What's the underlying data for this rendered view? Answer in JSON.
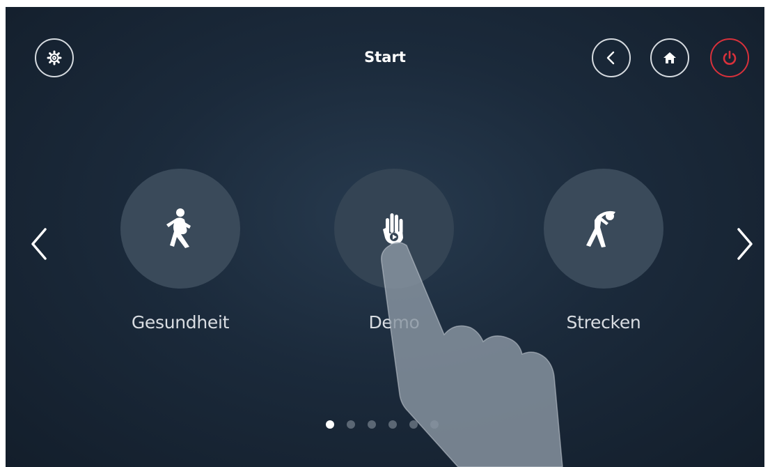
{
  "header": {
    "title": "Start",
    "settings_icon": "gear-icon",
    "back_icon": "chevron-left-icon",
    "home_icon": "home-icon",
    "power_icon": "power-icon"
  },
  "colors": {
    "background": "#1b2a3b",
    "tile_circle": "#3a4a5a",
    "power_accent": "#d8313b",
    "text": "#ffffff",
    "pager_active": "#ffffff",
    "pager_inactive": "#5b6774"
  },
  "carousel": {
    "tiles": [
      {
        "label": "Gesundheit",
        "icon": "walking-person-icon"
      },
      {
        "label": "Demo",
        "icon": "hand-play-icon"
      },
      {
        "label": "Strecken",
        "icon": "stretching-person-icon"
      }
    ],
    "pager": {
      "total": 6,
      "active": 1
    }
  }
}
